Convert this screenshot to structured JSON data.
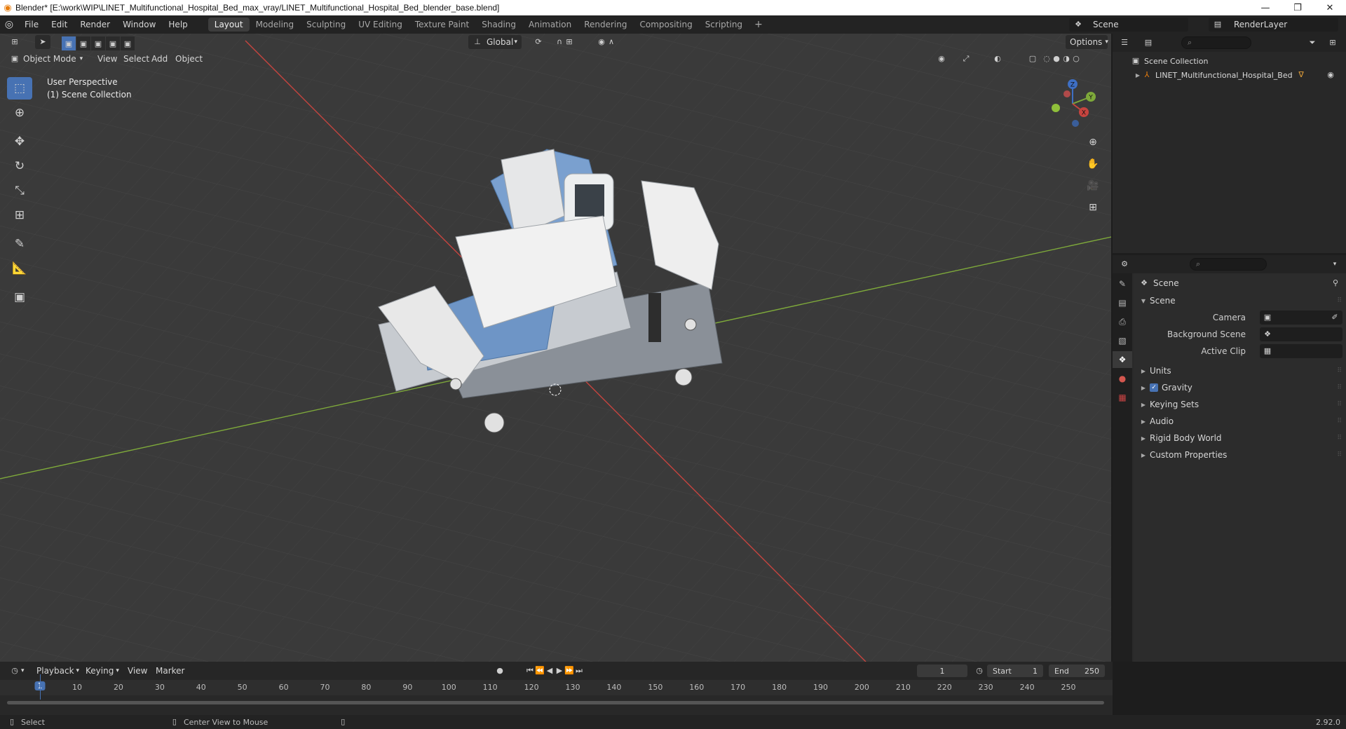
{
  "window": {
    "title": "Blender* [E:\\work\\WIP\\LINET_Multifunctional_Hospital_Bed_max_vray/LINET_Multifunctional_Hospital_Bed_blender_base.blend]",
    "controls": [
      "—",
      "❐",
      "✕"
    ]
  },
  "menu": {
    "items": [
      "File",
      "Edit",
      "Render",
      "Window",
      "Help"
    ],
    "workspaces": [
      "Layout",
      "Modeling",
      "Sculpting",
      "UV Editing",
      "Texture Paint",
      "Shading",
      "Animation",
      "Rendering",
      "Compositing",
      "Scripting"
    ],
    "active_workspace": "Layout",
    "add": "+",
    "scene": "Scene",
    "render_layer": "RenderLayer"
  },
  "viewport": {
    "mode": "Object Mode",
    "menus": [
      "View",
      "Select",
      "Add",
      "Object"
    ],
    "orientation": "Global",
    "options": "Options",
    "perspective_label": "User Perspective",
    "collection_label": "(1) Scene Collection",
    "gizmo_axes": [
      "Z",
      "Y",
      "X"
    ],
    "colors": {
      "grid_bg": "#3a3a3a",
      "x_axis": "#c6443f",
      "y_axis": "#7ea93a",
      "accent": "#4772b3"
    }
  },
  "toolbar": {
    "tools": [
      "select-box",
      "cursor",
      "move",
      "rotate",
      "scale",
      "transform",
      "annotate",
      "measure",
      "add-cube"
    ]
  },
  "outliner": {
    "search_placeholder": "",
    "root": "Scene Collection",
    "items": [
      {
        "name": "LINET_Multifunctional_Hospital_Bed"
      }
    ]
  },
  "properties": {
    "context": "Scene",
    "panel_title": "Scene",
    "fields": [
      {
        "label": "Camera",
        "value": ""
      },
      {
        "label": "Background Scene",
        "value": ""
      },
      {
        "label": "Active Clip",
        "value": ""
      }
    ],
    "sections": [
      "Units",
      "Gravity",
      "Keying Sets",
      "Audio",
      "Rigid Body World",
      "Custom Properties"
    ],
    "gravity_checked": true
  },
  "timeline": {
    "menus": [
      "Playback",
      "Keying",
      "View",
      "Marker"
    ],
    "current_frame": "1",
    "start_label": "Start",
    "start": "1",
    "end_label": "End",
    "end": "250",
    "ticks": [
      "1",
      "10",
      "20",
      "30",
      "40",
      "50",
      "60",
      "70",
      "80",
      "90",
      "100",
      "110",
      "120",
      "130",
      "140",
      "150",
      "160",
      "170",
      "180",
      "190",
      "200",
      "210",
      "220",
      "230",
      "240",
      "250"
    ]
  },
  "status": {
    "select": "Select",
    "center": "Center View to Mouse",
    "version": "2.92.0"
  }
}
